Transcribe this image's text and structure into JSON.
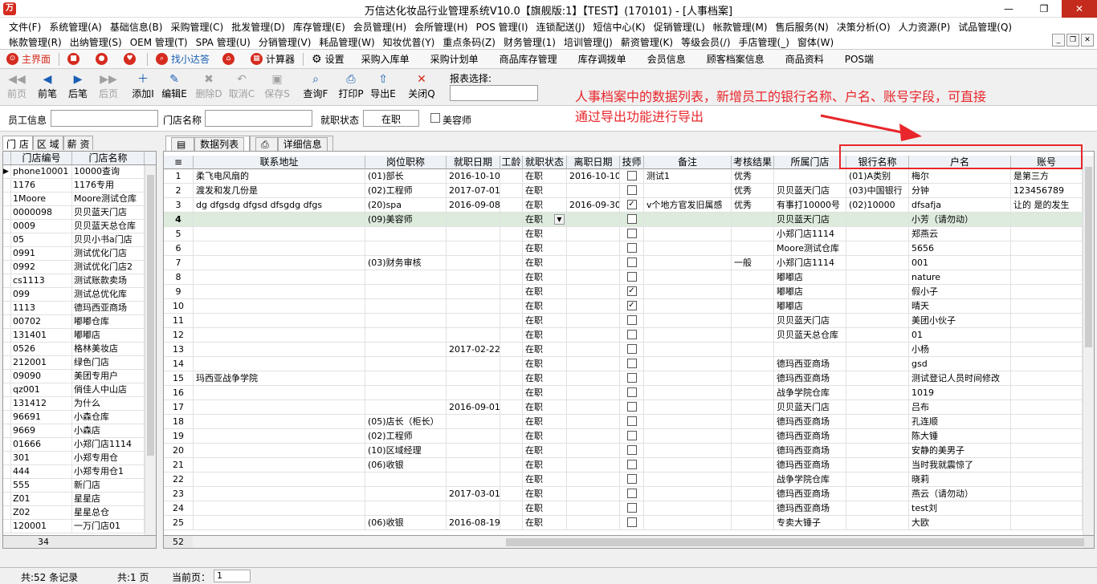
{
  "window": {
    "title": "万信达化妆品行业管理系统V10.0【旗舰版:1】【TEST】(170101) - [人事档案]",
    "minimize": "—",
    "restore": "❐",
    "close": "✕"
  },
  "menu": {
    "row1": [
      "文件(F)",
      "系统管理(A)",
      "基础信息(B)",
      "采购管理(C)",
      "批发管理(D)",
      "库存管理(E)",
      "会员管理(H)",
      "会所管理(H)",
      "POS 管理(I)",
      "连锁配送(J)",
      "短信中心(K)",
      "促销管理(L)",
      "帐款管理(M)",
      "售后服务(N)",
      "决策分析(O)",
      "人力资源(P)",
      "试品管理(Q)"
    ],
    "row2": [
      "帐款管理(R)",
      "出纳管理(S)",
      "OEM 管理(T)",
      "SPA 管理(U)",
      "分销管理(V)",
      "耗品管理(W)",
      "知妆优普(Y)",
      "重点条码(Z)",
      "财务管理(1)",
      "培训管理(J)",
      "薪资管理(K)",
      "等级会员(/)",
      "手店管理(_)",
      "窗体(W)"
    ]
  },
  "quickbar": {
    "home": "主界面",
    "find": "找小达答",
    "calc": "计算器",
    "settings": "设置",
    "items": [
      "采购入库单",
      "采购计划单",
      "商品库存管理",
      "库存调拨单",
      "会员信息",
      "顾客档案信息",
      "商品资料",
      "POS端"
    ]
  },
  "toolbar": {
    "buttons": [
      {
        "label": "前页",
        "icon": "◀◀",
        "enabled": false
      },
      {
        "label": "前笔",
        "icon": "◀",
        "enabled": true
      },
      {
        "label": "后笔",
        "icon": "▶",
        "enabled": true
      },
      {
        "label": "后页",
        "icon": "▶▶",
        "enabled": false
      },
      {
        "label": "添加I",
        "icon": "＋",
        "enabled": true
      },
      {
        "label": "编辑E",
        "icon": "✎",
        "enabled": true
      },
      {
        "label": "删除D",
        "icon": "✖",
        "enabled": false
      },
      {
        "label": "取消C",
        "icon": "↶",
        "enabled": false
      },
      {
        "label": "保存S",
        "icon": "▣",
        "enabled": false
      },
      {
        "label": "查询F",
        "icon": "⌕",
        "enabled": true
      },
      {
        "label": "打印P",
        "icon": "⎙",
        "enabled": true
      },
      {
        "label": "导出E",
        "icon": "⇧",
        "enabled": true
      },
      {
        "label": "关闭Q",
        "icon": "✕",
        "enabled": true
      }
    ],
    "report_label": "报表选择:"
  },
  "annotation": {
    "line1": "人事档案中的数据列表，新增员工的银行名称、户名、账号字段，可直接",
    "line2": "通过导出功能进行导出"
  },
  "filter": {
    "employee_label": "员工信息",
    "store_label": "门店名称",
    "status_label": "就职状态",
    "status_value": "在职",
    "beauty_label": "美容师"
  },
  "left_tabs": [
    "门 店",
    "区 域",
    "薪 资"
  ],
  "store_list": {
    "headers": [
      "门店编号",
      "门店名称"
    ],
    "rows": [
      [
        "phone10001",
        "10000查询"
      ],
      [
        "1176",
        "1176专用"
      ],
      [
        "1Moore",
        "Moore测试仓库"
      ],
      [
        "0000098",
        "贝贝蓝天门店"
      ],
      [
        "0009",
        "贝贝蓝天总仓库"
      ],
      [
        "05",
        "贝贝小书a门店"
      ],
      [
        "0991",
        "测试优化门店"
      ],
      [
        "0992",
        "测试优化门店2"
      ],
      [
        "cs1113",
        "测试账款卖场"
      ],
      [
        "099",
        "测试总优化库"
      ],
      [
        "1113",
        "德玛西亚商场"
      ],
      [
        "00702",
        "嘟嘟仓库"
      ],
      [
        "131401",
        "嘟嘟店"
      ],
      [
        "0526",
        "格林美妆店"
      ],
      [
        "212001",
        "绿色门店"
      ],
      [
        "09090",
        "美团专用户"
      ],
      [
        "qz001",
        "俏佳人中山店"
      ],
      [
        "131412",
        "为什么"
      ],
      [
        "96691",
        "小森仓库"
      ],
      [
        "9669",
        "小森店"
      ],
      [
        "01666",
        "小郑门店1114"
      ],
      [
        "301",
        "小郑专用仓"
      ],
      [
        "444",
        "小郑专用仓1"
      ],
      [
        "555",
        "新门店"
      ],
      [
        "Z01",
        "星星店"
      ],
      [
        "Z02",
        "星星总仓"
      ],
      [
        "120001",
        "一万门店01"
      ]
    ],
    "count": "34"
  },
  "right_tabs": [
    "数据列表",
    "详细信息"
  ],
  "grid": {
    "headers": [
      "联系地址",
      "岗位职称",
      "就职日期",
      "工龄",
      "就职状态",
      "离职日期",
      "技师",
      "备注",
      "考核结果",
      "所属门店",
      "银行名称",
      "户名",
      "账号"
    ],
    "rows": [
      {
        "n": "1",
        "addr": "柔飞电风扇的",
        "title": "(01)部长",
        "join": "2016-10-10",
        "status": "在职",
        "leave": "2016-10-10",
        "tech": false,
        "note": "测试1",
        "eval": "优秀",
        "store": "",
        "bank": "(01)A类别",
        "holder": "梅尔",
        "acct": "是第三方"
      },
      {
        "n": "2",
        "addr": "渡发和发几份是",
        "title": "(02)工程师",
        "join": "2017-07-01",
        "status": "在职",
        "leave": "",
        "tech": false,
        "note": "",
        "eval": "优秀",
        "store": "贝贝蓝天门店",
        "bank": "(03)中国银行",
        "holder": "分钟",
        "acct": "123456789"
      },
      {
        "n": "3",
        "addr": "dg dfgsdg dfgsd dfsgdg dfgs",
        "title": "(20)spa",
        "join": "2016-09-08",
        "status": "在职",
        "leave": "2016-09-30",
        "tech": true,
        "note": "v个地方官发旧属感",
        "eval": "优秀",
        "store": "有事打10000号",
        "bank": "(02)10000",
        "holder": "dfsafja",
        "acct": "让的 是的发生"
      },
      {
        "n": "4",
        "addr": "",
        "title": "(09)美容师",
        "join": "",
        "status": "在职",
        "leave": "",
        "tech": false,
        "note": "",
        "eval": "",
        "store": "贝贝蓝天门店",
        "bank": "",
        "holder": "小芳（请勿动）",
        "acct": ""
      },
      {
        "n": "5",
        "addr": "",
        "title": "",
        "join": "",
        "status": "在职",
        "leave": "",
        "tech": false,
        "note": "",
        "eval": "",
        "store": "小郑门店1114",
        "bank": "",
        "holder": "郑燕云",
        "acct": ""
      },
      {
        "n": "6",
        "addr": "",
        "title": "",
        "join": "",
        "status": "在职",
        "leave": "",
        "tech": false,
        "note": "",
        "eval": "",
        "store": "Moore测试仓库",
        "bank": "",
        "holder": "5656",
        "acct": ""
      },
      {
        "n": "7",
        "addr": "",
        "title": "(03)财务审核",
        "join": "",
        "status": "在职",
        "leave": "",
        "tech": false,
        "note": "",
        "eval": "一般",
        "store": "小郑门店1114",
        "bank": "",
        "holder": "001",
        "acct": ""
      },
      {
        "n": "8",
        "addr": "",
        "title": "",
        "join": "",
        "status": "在职",
        "leave": "",
        "tech": false,
        "note": "",
        "eval": "",
        "store": "嘟嘟店",
        "bank": "",
        "holder": "nature",
        "acct": ""
      },
      {
        "n": "9",
        "addr": "",
        "title": "",
        "join": "",
        "status": "在职",
        "leave": "",
        "tech": true,
        "note": "",
        "eval": "",
        "store": "嘟嘟店",
        "bank": "",
        "holder": "假小子",
        "acct": ""
      },
      {
        "n": "10",
        "addr": "",
        "title": "",
        "join": "",
        "status": "在职",
        "leave": "",
        "tech": true,
        "note": "",
        "eval": "",
        "store": "嘟嘟店",
        "bank": "",
        "holder": "晴天",
        "acct": ""
      },
      {
        "n": "11",
        "addr": "",
        "title": "",
        "join": "",
        "status": "在职",
        "leave": "",
        "tech": false,
        "note": "",
        "eval": "",
        "store": "贝贝蓝天门店",
        "bank": "",
        "holder": "美团小伙子",
        "acct": ""
      },
      {
        "n": "12",
        "addr": "",
        "title": "",
        "join": "",
        "status": "在职",
        "leave": "",
        "tech": false,
        "note": "",
        "eval": "",
        "store": "贝贝蓝天总仓库",
        "bank": "",
        "holder": "01",
        "acct": ""
      },
      {
        "n": "13",
        "addr": "",
        "title": "",
        "join": "2017-02-22",
        "status": "在职",
        "leave": "",
        "tech": false,
        "note": "",
        "eval": "",
        "store": "",
        "bank": "",
        "holder": "小杨",
        "acct": ""
      },
      {
        "n": "14",
        "addr": "",
        "title": "",
        "join": "",
        "status": "在职",
        "leave": "",
        "tech": false,
        "note": "",
        "eval": "",
        "store": "德玛西亚商场",
        "bank": "",
        "holder": "gsd",
        "acct": ""
      },
      {
        "n": "15",
        "addr": "玛西亚战争学院",
        "title": "",
        "join": "",
        "status": "在职",
        "leave": "",
        "tech": false,
        "note": "",
        "eval": "",
        "store": "德玛西亚商场",
        "bank": "",
        "holder": "测试登记人员时间修改",
        "acct": ""
      },
      {
        "n": "16",
        "addr": "",
        "title": "",
        "join": "",
        "status": "在职",
        "leave": "",
        "tech": false,
        "note": "",
        "eval": "",
        "store": "战争学院仓库",
        "bank": "",
        "holder": "1019",
        "acct": ""
      },
      {
        "n": "17",
        "addr": "",
        "title": "",
        "join": "2016-09-01",
        "status": "在职",
        "leave": "",
        "tech": false,
        "note": "",
        "eval": "",
        "store": "贝贝蓝天门店",
        "bank": "",
        "holder": "吕布",
        "acct": ""
      },
      {
        "n": "18",
        "addr": "",
        "title": "(05)店长（柜长）",
        "join": "",
        "status": "在职",
        "leave": "",
        "tech": false,
        "note": "",
        "eval": "",
        "store": "德玛西亚商场",
        "bank": "",
        "holder": "孔连顺",
        "acct": ""
      },
      {
        "n": "19",
        "addr": "",
        "title": "(02)工程师",
        "join": "",
        "status": "在职",
        "leave": "",
        "tech": false,
        "note": "",
        "eval": "",
        "store": "德玛西亚商场",
        "bank": "",
        "holder": "陈大锤",
        "acct": ""
      },
      {
        "n": "20",
        "addr": "",
        "title": "(10)区域经理",
        "join": "",
        "status": "在职",
        "leave": "",
        "tech": false,
        "note": "",
        "eval": "",
        "store": "德玛西亚商场",
        "bank": "",
        "holder": "安静的美男子",
        "acct": ""
      },
      {
        "n": "21",
        "addr": "",
        "title": "(06)收银",
        "join": "",
        "status": "在职",
        "leave": "",
        "tech": false,
        "note": "",
        "eval": "",
        "store": "德玛西亚商场",
        "bank": "",
        "holder": "当时我就震惊了",
        "acct": ""
      },
      {
        "n": "22",
        "addr": "",
        "title": "",
        "join": "",
        "status": "在职",
        "leave": "",
        "tech": false,
        "note": "",
        "eval": "",
        "store": "战争学院仓库",
        "bank": "",
        "holder": "晓莉",
        "acct": ""
      },
      {
        "n": "23",
        "addr": "",
        "title": "",
        "join": "2017-03-01",
        "status": "在职",
        "leave": "",
        "tech": false,
        "note": "",
        "eval": "",
        "store": "德玛西亚商场",
        "bank": "",
        "holder": "燕云（请勿动）",
        "acct": ""
      },
      {
        "n": "24",
        "addr": "",
        "title": "",
        "join": "",
        "status": "在职",
        "leave": "",
        "tech": false,
        "note": "",
        "eval": "",
        "store": "德玛西亚商场",
        "bank": "",
        "holder": "test刘",
        "acct": ""
      },
      {
        "n": "25",
        "addr": "",
        "title": "(06)收银",
        "join": "2016-08-19",
        "status": "在职",
        "leave": "",
        "tech": false,
        "note": "",
        "eval": "",
        "store": "专卖大锤子",
        "bank": "",
        "holder": "大欧",
        "acct": ""
      }
    ],
    "count": "52"
  },
  "status": {
    "records": "共:52 条记录",
    "pages": "共:1 页",
    "current_label": "当前页：",
    "current_value": "1"
  },
  "colors": {
    "accent": "#e8262b",
    "selected_row": "#dcebdc"
  }
}
